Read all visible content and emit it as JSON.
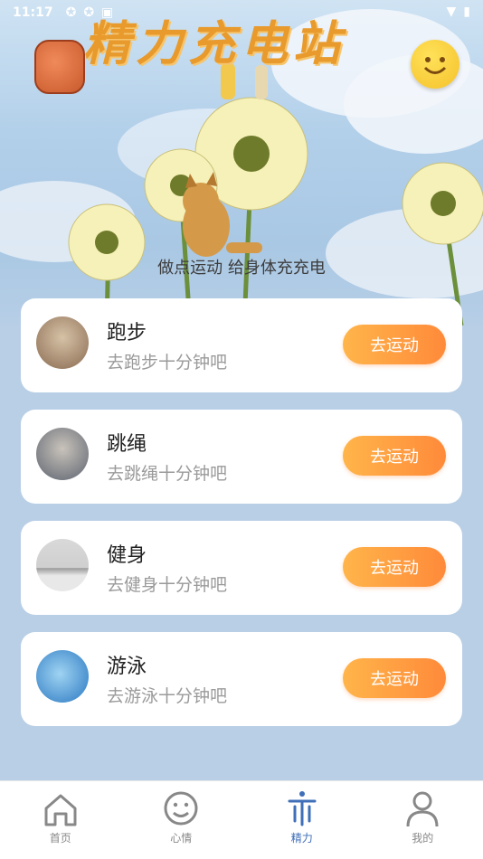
{
  "status_bar": {
    "time": "11:17"
  },
  "app": {
    "title": "精力充电站",
    "subtitle": "做点运动 给身体充充电"
  },
  "activities": [
    {
      "title": "跑步",
      "subtitle": "去跑步十分钟吧",
      "button": "去运动",
      "thumb_color": "#b28b6a"
    },
    {
      "title": "跳绳",
      "subtitle": "去跳绳十分钟吧",
      "button": "去运动",
      "thumb_color": "#8a8f99"
    },
    {
      "title": "健身",
      "subtitle": "去健身十分钟吧",
      "button": "去运动",
      "thumb_color": "#c9c9c9"
    },
    {
      "title": "游泳",
      "subtitle": "去游泳十分钟吧",
      "button": "去运动",
      "thumb_color": "#3c8bd1"
    }
  ],
  "tabs": [
    {
      "label": "首页",
      "icon": "home-icon"
    },
    {
      "label": "心情",
      "icon": "smile-icon"
    },
    {
      "label": "精力",
      "icon": "energy-icon"
    },
    {
      "label": "我的",
      "icon": "person-icon"
    }
  ],
  "colors": {
    "accent": "#3f6fb8",
    "button": "#ff9a40"
  }
}
